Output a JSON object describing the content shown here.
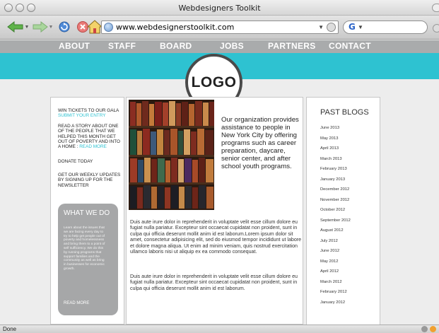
{
  "window": {
    "title": "Webdesigners Toolkit"
  },
  "toolbar": {
    "url": "www.webdesignerstoolkit.com",
    "search_placeholder": ""
  },
  "nav": {
    "items": [
      "ABOUT",
      "STAFF",
      "BOARD",
      "JOBS",
      "PARTNERS",
      "CONTACT"
    ]
  },
  "logo": {
    "text": "LOGO"
  },
  "left": {
    "gala_line": "WIN TICKETS TO OUR GALA",
    "gala_link": "SUBMIT YOUR ENTRY",
    "story_text": "READ A STORY ABOUT ONE OF THE PEOPLE THAT WE HELPED THIS MONTH GET OUT OF POVERTY AND INTO A HOME",
    "story_link": "READ MORE",
    "donate": "DONATE TODAY",
    "updates": "GET OUR WEEKLY UPDATES BY SIGNING UP FOR THE NEWSLETTER",
    "what_title": "WHAT WE DO",
    "what_text": "Learn about the issues that we are facing every day to try to help get people out of poverty and homelessness and bring them to a point of self sufficiency. We do this by running programs that support families and the community as well as bring in businesses for economic growth.",
    "what_more": "READ MORE"
  },
  "main": {
    "intro": "Our organization provides assistance to people in New York City by offering programs such as career preparation, daycare, senior center, and after school youth programs.",
    "para1": "Duis aute irure dolor in reprehenderit in voluptate velit esse cillum dolore eu fugiat nulla pariatur. Excepteur sint occaecat cupidatat non proident, sunt in culpa qui officia deserunt mollit anim id est laborum.Lorem ipsum dolor sit amet, consectetur adipisicing elit, sed do eiusmod tempor incididunt ut labore et dolore magna aliqua. Ut enim ad minim veniam, quis nostrud exercitation ullamco laboris nisi ut aliquip ex ea commodo consequat.",
    "para2": "Duis aute irure dolor in reprehenderit in voluptate velit esse cillum dolore eu fugiat nulla pariatur. Excepteur sint occaecat cupidatat non proident, sunt in culpa qui officia deserunt mollit anim id est laborum."
  },
  "past_blogs": {
    "title": "PAST BLOGS",
    "items": [
      "June 2013",
      "May 2013",
      "April 2013",
      "March 2013",
      "February 2013",
      "January 2013",
      "December 2012",
      "November 2012",
      "October 2012",
      "September 2012",
      "August 2012",
      "July 2012",
      "June 2012",
      "May 2012",
      "April 2012",
      "March 2012",
      "February 2012",
      "January 2012"
    ]
  },
  "status": {
    "text": "Done"
  },
  "colors": {
    "accent": "#2ec2d1",
    "nav": "#a9abac"
  }
}
